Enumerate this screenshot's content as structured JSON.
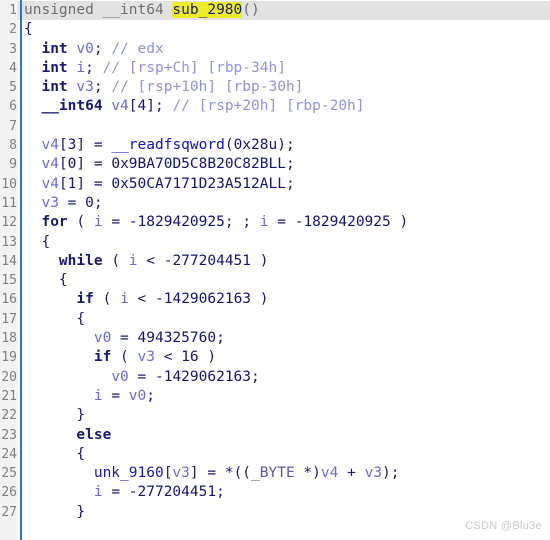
{
  "editor": {
    "name": "ida-pseudocode-view",
    "function_name": "sub_2980",
    "highlighted_token": "sub_2980",
    "watermark": "CSDN @Blu3e",
    "gutter": {
      "first_line": 1,
      "last_line": 27,
      "line_numbers": [
        "1",
        "2",
        "3",
        "4",
        "5",
        "6",
        "7",
        "8",
        "9",
        "10",
        "11",
        "12",
        "13",
        "14",
        "15",
        "16",
        "17",
        "18",
        "19",
        "20",
        "21",
        "22",
        "23",
        "24",
        "25",
        "26",
        "27"
      ]
    },
    "colors": {
      "background": "#ffffff",
      "gutter_background": "#f2f2f2",
      "gutter_rule": "#1f79c4",
      "current_line_background": "#e2e2e2",
      "highlight_background": "#ecec2a",
      "line_number": "#808080",
      "keyword": "#16197a",
      "variable": "#6a6ae0",
      "function": "#1010c8",
      "comment": "#8f93e0",
      "number": "#13137d",
      "watermark": "#c9c9c9"
    },
    "lines": [
      {
        "n": "1",
        "text": "unsigned __int64 sub_2980()",
        "current": true
      },
      {
        "n": "2",
        "text": "{",
        "current": false
      },
      {
        "n": "3",
        "text": "  int v0; // edx",
        "current": false
      },
      {
        "n": "4",
        "text": "  int i; // [rsp+Ch] [rbp-34h]",
        "current": false
      },
      {
        "n": "5",
        "text": "  int v3; // [rsp+10h] [rbp-30h]",
        "current": false
      },
      {
        "n": "6",
        "text": "  __int64 v4[4]; // [rsp+20h] [rbp-20h]",
        "current": false
      },
      {
        "n": "7",
        "text": "",
        "current": false
      },
      {
        "n": "8",
        "text": "  v4[3] = __readfsqword(0x28u);",
        "current": false
      },
      {
        "n": "9",
        "text": "  v4[0] = 0x9BA70D5C8B20C82BLL;",
        "current": false
      },
      {
        "n": "10",
        "text": "  v4[1] = 0x50CA7171D23A512ALL;",
        "current": false
      },
      {
        "n": "11",
        "text": "  v3 = 0;",
        "current": false
      },
      {
        "n": "12",
        "text": "  for ( i = -1829420925; ; i = -1829420925 )",
        "current": false
      },
      {
        "n": "13",
        "text": "  {",
        "current": false
      },
      {
        "n": "14",
        "text": "    while ( i < -277204451 )",
        "current": false
      },
      {
        "n": "15",
        "text": "    {",
        "current": false
      },
      {
        "n": "16",
        "text": "      if ( i < -1429062163 )",
        "current": false
      },
      {
        "n": "17",
        "text": "      {",
        "current": false
      },
      {
        "n": "18",
        "text": "        v0 = 494325760;",
        "current": false
      },
      {
        "n": "19",
        "text": "        if ( v3 < 16 )",
        "current": false
      },
      {
        "n": "20",
        "text": "          v0 = -1429062163;",
        "current": false
      },
      {
        "n": "21",
        "text": "        i = v0;",
        "current": false
      },
      {
        "n": "22",
        "text": "      }",
        "current": false
      },
      {
        "n": "23",
        "text": "      else",
        "current": false
      },
      {
        "n": "24",
        "text": "      {",
        "current": false
      },
      {
        "n": "25",
        "text": "        unk_9160[v3] = *((_BYTE *)v4 + v3);",
        "current": false
      },
      {
        "n": "26",
        "text": "        i = -277204451;",
        "current": false
      },
      {
        "n": "27",
        "text": "      }",
        "current": false
      }
    ]
  }
}
